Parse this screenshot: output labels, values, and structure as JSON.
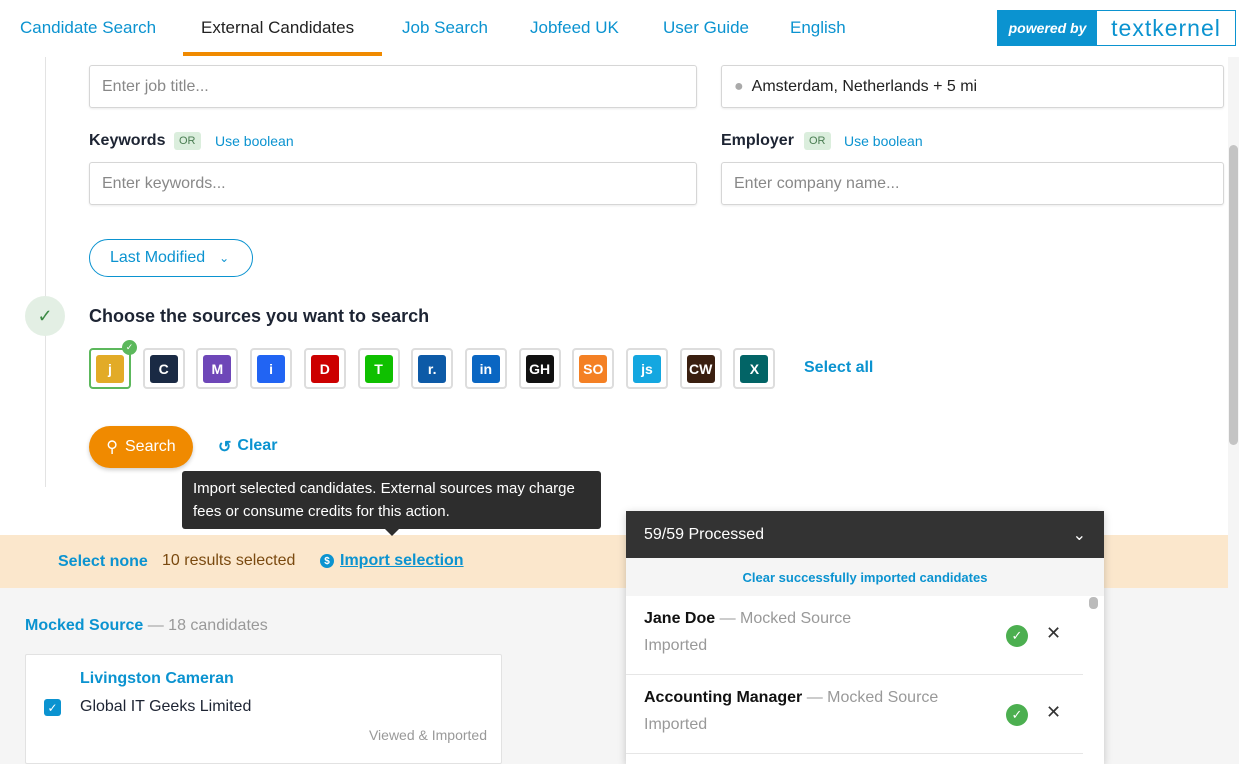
{
  "nav": {
    "tabs": [
      "Candidate Search",
      "External Candidates",
      "Job Search",
      "Jobfeed UK",
      "User Guide",
      "English"
    ],
    "active": "External Candidates",
    "powered_by": "powered by",
    "brand": "textkernel"
  },
  "form": {
    "job_title_placeholder": "Enter job title...",
    "location_value": "Amsterdam, Netherlands + 5 mi",
    "keywords_label": "Keywords",
    "keywords_or": "OR",
    "keywords_boolean": "Use boolean",
    "keywords_placeholder": "Enter keywords...",
    "employer_label": "Employer",
    "employer_or": "OR",
    "employer_boolean": "Use boolean",
    "employer_placeholder": "Enter company name...",
    "sort_label": "Last Modified"
  },
  "sources": {
    "title": "Choose the sources you want to search",
    "select_all": "Select all",
    "items": [
      {
        "icon": "jobboard-icon",
        "glyph": "j",
        "color": "#e2ab27",
        "selected": true
      },
      {
        "icon": "careerbuilder-icon",
        "glyph": "C",
        "color": "#1a2a44"
      },
      {
        "icon": "monster-icon",
        "glyph": "M",
        "color": "#6e47b8"
      },
      {
        "icon": "indeed-icon",
        "glyph": "i",
        "color": "#2164f3"
      },
      {
        "icon": "dice-icon",
        "glyph": "D",
        "color": "#cc0000"
      },
      {
        "icon": "totaljobs-icon",
        "glyph": "T",
        "color": "#0fc000"
      },
      {
        "icon": "reed-icon",
        "glyph": "r.",
        "color": "#0d5aa7"
      },
      {
        "icon": "linkedin-icon",
        "glyph": "in",
        "color": "#0a66c2"
      },
      {
        "icon": "github-icon",
        "glyph": "GH",
        "color": "#111111"
      },
      {
        "icon": "stackoverflow-icon",
        "glyph": "SO",
        "color": "#f48024"
      },
      {
        "icon": "jobserve-icon",
        "glyph": "js",
        "color": "#14a7e0"
      },
      {
        "icon": "cwjobs-icon",
        "glyph": "CW",
        "color": "#3a1f10"
      },
      {
        "icon": "xing-icon",
        "glyph": "X",
        "color": "#026466"
      }
    ]
  },
  "actions": {
    "search": "Search",
    "clear": "Clear",
    "tooltip": "Import selected candidates. External sources may charge fees or consume credits for this action."
  },
  "selection": {
    "select_none": "Select none",
    "count": "10 results selected",
    "import": "Import selection"
  },
  "results": {
    "source": "Mocked Source",
    "count": "— 18 candidates",
    "card": {
      "name": "Livingston Cameran",
      "company": "Global IT Geeks Limited",
      "status": "Viewed & Imported",
      "checked": true
    }
  },
  "panel": {
    "title": "59/59 Processed",
    "clear": "Clear successfully imported candidates",
    "rows": [
      {
        "name": "Jane Doe",
        "source": "— Mocked Source",
        "status": "Imported"
      },
      {
        "name": "Accounting Manager",
        "source": "— Mocked Source",
        "status": "Imported"
      }
    ]
  },
  "colors": {
    "accent": "#0b93d0",
    "orange": "#f08a00",
    "banner": "#fbe7cc"
  }
}
